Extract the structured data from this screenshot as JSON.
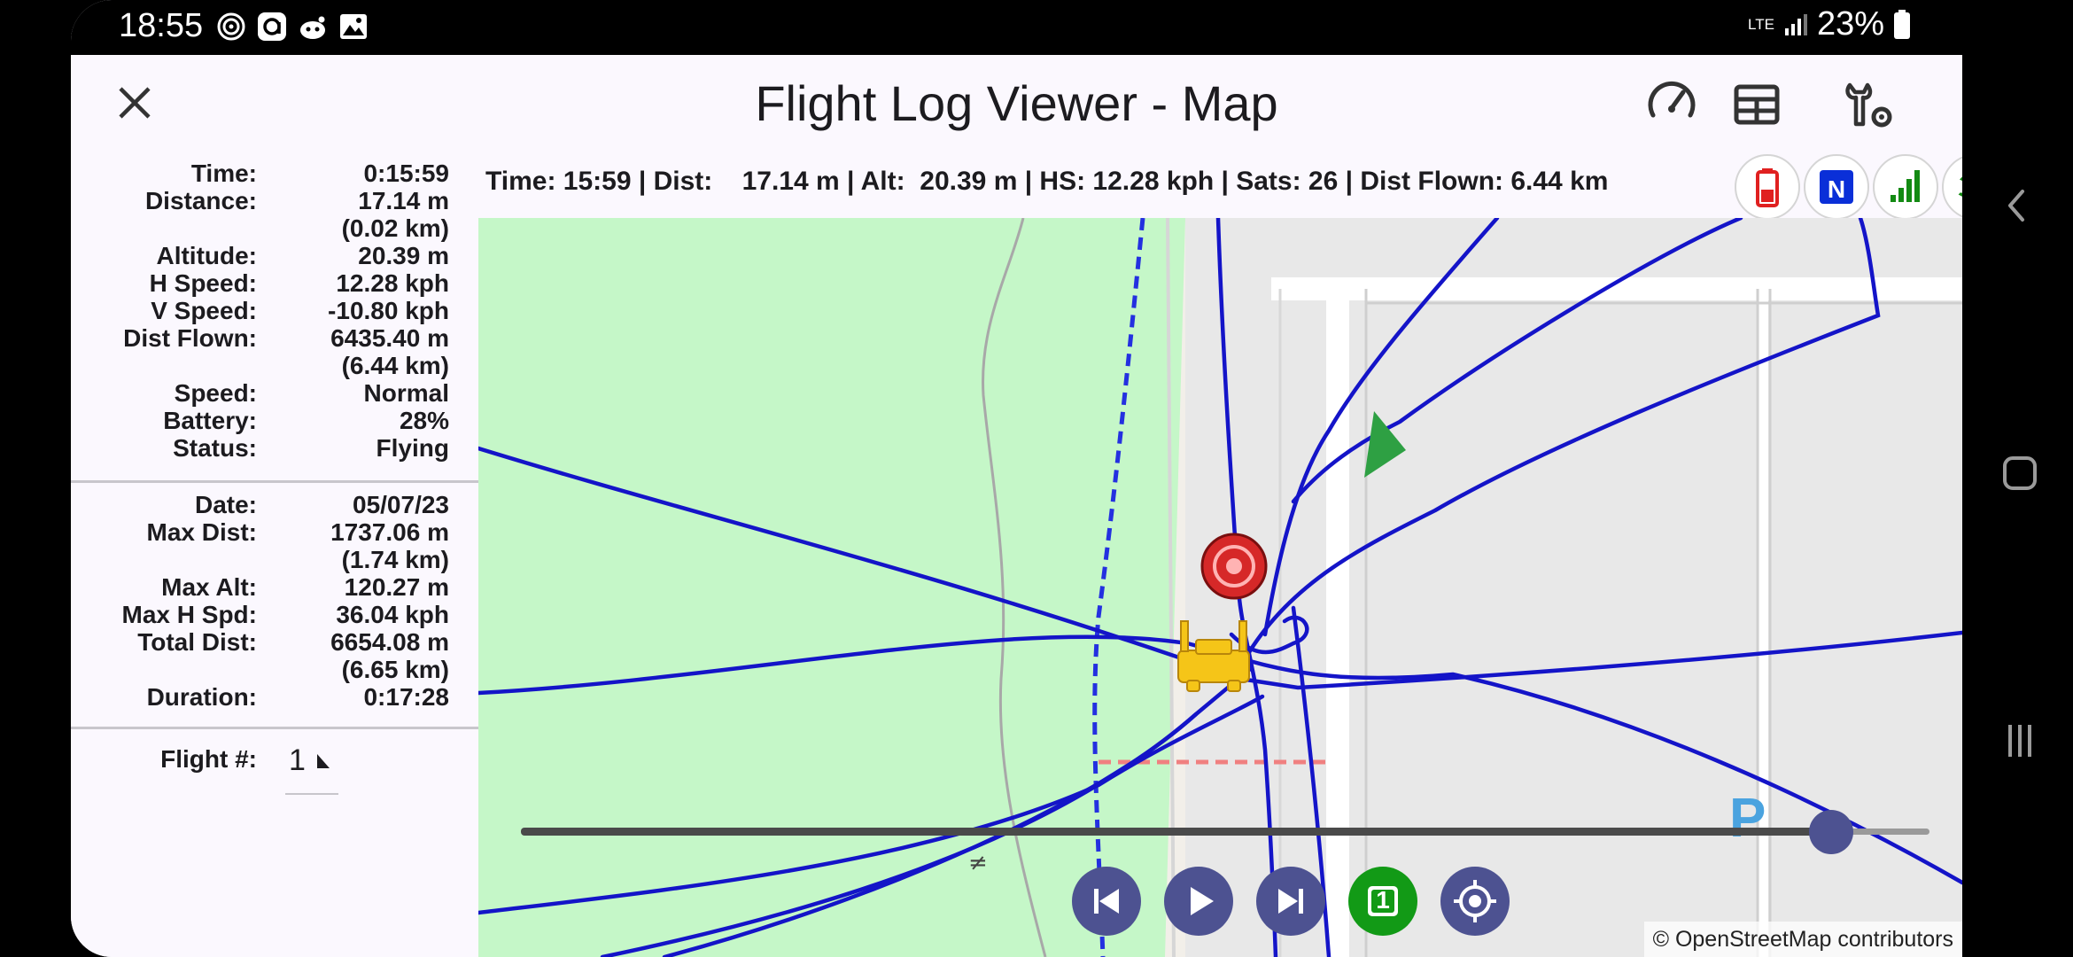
{
  "status_bar": {
    "time": "18:55",
    "network": "LTE",
    "battery_percent": "23%",
    "notification_icons": [
      "fingerprint-icon",
      "app-icon",
      "reddit-icon",
      "image-icon"
    ]
  },
  "app_bar": {
    "title": "Flight Log Viewer - Map",
    "actions": [
      "close-icon",
      "gauge-icon",
      "table-icon",
      "settings-wrench-icon"
    ]
  },
  "stats": {
    "time": {
      "label": "Time:",
      "value": "0:15:59"
    },
    "distance": {
      "label": "Distance:",
      "value": "17.14 m",
      "value2": "(0.02 km)"
    },
    "altitude": {
      "label": "Altitude:",
      "value": "20.39 m"
    },
    "h_speed": {
      "label": "H Speed:",
      "value": "12.28 kph"
    },
    "v_speed": {
      "label": "V Speed:",
      "value": "-10.80 kph"
    },
    "dist_flown": {
      "label": "Dist Flown:",
      "value": "6435.40 m",
      "value2": "(6.44 km)"
    },
    "speed": {
      "label": "Speed:",
      "value": "Normal"
    },
    "battery": {
      "label": "Battery:",
      "value": "28%"
    },
    "status": {
      "label": "Status:",
      "value": "Flying"
    }
  },
  "summary": {
    "date": {
      "label": "Date:",
      "value": "05/07/23"
    },
    "max_dist": {
      "label": "Max Dist:",
      "value": "1737.06 m",
      "value2": "(1.74 km)"
    },
    "max_alt": {
      "label": "Max Alt:",
      "value": "120.27 m"
    },
    "max_h_spd": {
      "label": "Max H Spd:",
      "value": "36.04 kph"
    },
    "total_dist": {
      "label": "Total Dist:",
      "value": "6654.08 m",
      "value2": "(6.65 km)"
    },
    "duration": {
      "label": "Duration:",
      "value": "0:17:28"
    }
  },
  "flight_selector": {
    "label": "Flight #:",
    "value": "1"
  },
  "map": {
    "info_text": "Time: 15:59 | Dist:    17.14 m | Alt:  20.39 m | HS: 12.28 kph | Sats: 26 | Dist Flown: 6.44 km",
    "indicators": [
      "battery-low-icon",
      "gps-n-icon",
      "signal-bars-icon",
      "airplane-icon"
    ],
    "playback_progress": 0.93,
    "controls": [
      "skip-previous-icon",
      "play-icon",
      "skip-next-icon",
      "flight-one-icon",
      "locate-icon"
    ],
    "flight_badge": "1",
    "map_label_p": "P",
    "attribution": "© OpenStreetMap contributors",
    "colors": {
      "track": "#1414c8",
      "park": "#c5f7c8",
      "building": "#e8e8e8",
      "control_button": "#4d5291",
      "home_marker": "#d62828",
      "drone_arrow": "#2ea043",
      "controller_icon": "#f5c518"
    }
  },
  "nav_bar": {
    "buttons": [
      "back-icon",
      "home-icon",
      "recents-icon"
    ]
  }
}
